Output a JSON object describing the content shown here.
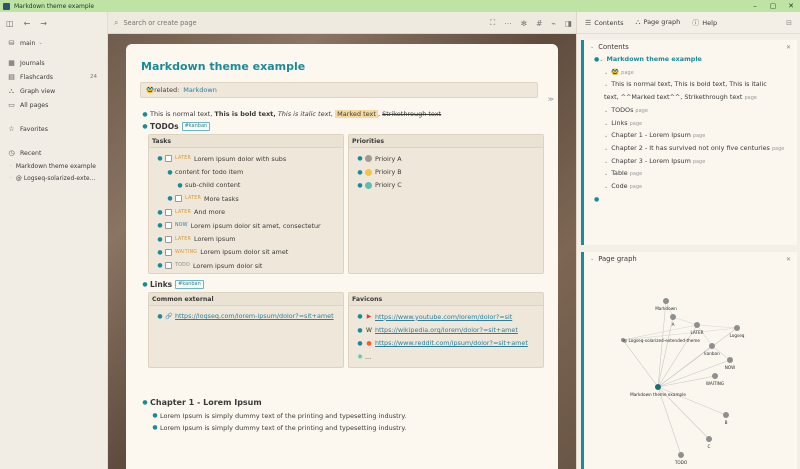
{
  "window": {
    "title": "Markdown theme example"
  },
  "sidebar": {
    "graph_name": "main",
    "items": [
      {
        "label": "Journals",
        "icon": "calendar-icon",
        "glyph": "▦"
      },
      {
        "label": "Flashcards",
        "icon": "flashcards-icon",
        "glyph": "▤",
        "badge": "24"
      },
      {
        "label": "Graph view",
        "icon": "graph-icon",
        "glyph": "⛬"
      },
      {
        "label": "All pages",
        "icon": "pages-icon",
        "glyph": "▭"
      }
    ],
    "favorites_label": "Favorites",
    "recent_label": "Recent",
    "recent": [
      "Markdown theme example",
      "@ Logseq-solarized-exte..."
    ]
  },
  "topbar": {
    "search_placeholder": "Search or create page"
  },
  "page": {
    "title": "Markdown theme example",
    "related_label": "related:",
    "related_link": "Markdown",
    "normal_text": "This is normal text,",
    "bold_text": "This is bold text,",
    "italic_text": "This is italic text,",
    "marked_text": "Marked text",
    "strike_text": "Strikethrough text",
    "todos_heading": "TODOs",
    "kanban_tag": "#kanban",
    "tasks_col": "Tasks",
    "priorities_col": "Priorities",
    "tasks": [
      {
        "kw": "LATER",
        "text": "Lorem ipsum dolor with subs"
      },
      {
        "text": "content for todo item"
      },
      {
        "text": "sub-child content"
      },
      {
        "kw": "LATER",
        "text": "More tasks"
      },
      {
        "kw": "LATER",
        "text": "And more"
      },
      {
        "kw": "NOW",
        "text": "Lorem ipsum dolor sit amet, consectetur"
      },
      {
        "kw": "LATER",
        "text": "Lorem ipsum"
      },
      {
        "kw": "WAITING",
        "text": "Lorem ipsum dolor sit amet"
      },
      {
        "kw": "TODO",
        "text": "Lorem ipsum dolor sit"
      }
    ],
    "priorities": [
      {
        "text": "Prioiry A",
        "color": "#a09a94"
      },
      {
        "text": "Prioiry B",
        "color": "#f1c44b"
      },
      {
        "text": "Prioiry C",
        "color": "#5bbfb3"
      }
    ],
    "links_heading": "Links",
    "external_col": "Common external",
    "favicons_col": "Favicons",
    "external_link": "https://logseq.com/lorem-ipsum/dolor?=sit+amet",
    "favicons": [
      {
        "icon": "youtube-icon",
        "glyph": "▶",
        "color": "#e03a3a",
        "url": "https://www.youtube.com/lorem/dolor?=sit"
      },
      {
        "icon": "wikipedia-icon",
        "glyph": "W",
        "color": "#333333",
        "url": "https://wikipedia.org/lorem/dolor?=sit+amet"
      },
      {
        "icon": "reddit-icon",
        "glyph": "●",
        "color": "#ff5a1f",
        "url": "https://www.reddit.com/ipsum/dolor?=sit+amet"
      }
    ],
    "ellipsis": "...",
    "chapter1_heading": "Chapter 1 - Lorem Ipsum",
    "lorem_lines": [
      "Lorem Ipsum is simply dummy text of the printing and typesetting industry.",
      "Lorem Ipsum is simply dummy text of the printing and typesetting industry."
    ]
  },
  "right_panel": {
    "contents_label": "Contents",
    "page_graph_label": "Page graph",
    "help_label": "Help",
    "page_tag": "page",
    "toc_root": "Markdown theme example",
    "toc": [
      {
        "text": "",
        "emoji": true,
        "page": true
      },
      {
        "text": "This is normal text, This is bold text, This is italic text, ^^Marked text^^, Strikethrough text",
        "page": true
      },
      {
        "text": "TODOs",
        "page": true
      },
      {
        "text": "Links",
        "page": true
      },
      {
        "text": "Chapter 1 - Lorem Ipsum",
        "page": true
      },
      {
        "text": "Chapter 2 - It has survived not only five centuries",
        "page": true
      },
      {
        "text": "Chapter 3 - Lorem Ipsum",
        "page": true
      },
      {
        "text": "Table",
        "page": true
      },
      {
        "text": "Code",
        "page": true
      }
    ],
    "graph_nodes": [
      {
        "label": "Markdown"
      },
      {
        "label": "A"
      },
      {
        "label": "LATER"
      },
      {
        "label": "Logseq"
      },
      {
        "label": "@ Logseq-solarized-extended-theme"
      },
      {
        "label": "kanban"
      },
      {
        "label": "NOW"
      },
      {
        "label": "WAITING"
      },
      {
        "label": "Markdown theme example"
      },
      {
        "label": "B"
      },
      {
        "label": "C"
      },
      {
        "label": "TODO"
      }
    ]
  }
}
